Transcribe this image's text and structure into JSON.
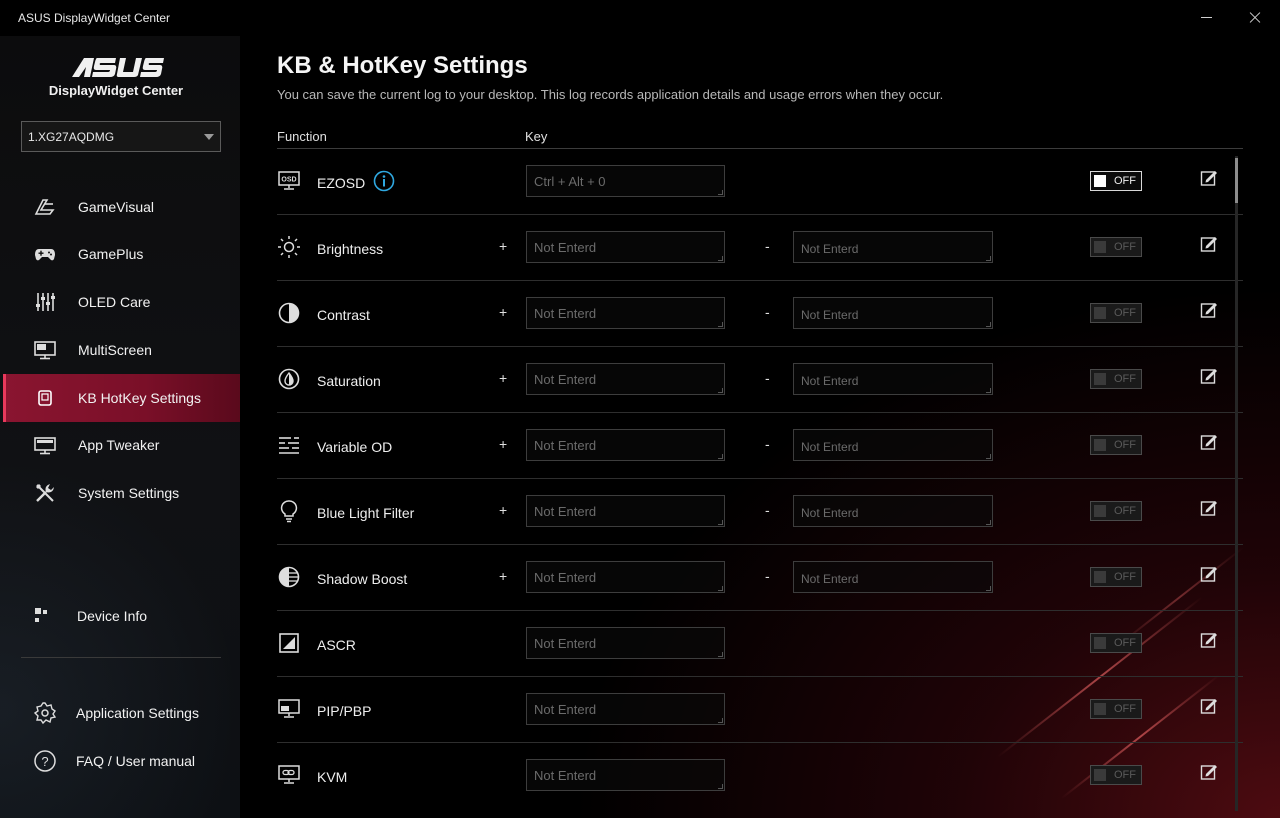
{
  "window": {
    "title": "ASUS DisplayWidget Center"
  },
  "sidebar": {
    "app_name": "DisplayWidget Center",
    "device": "1.XG27AQDMG",
    "items": [
      {
        "label": "GameVisual",
        "icon": "gamevisual-icon"
      },
      {
        "label": "GamePlus",
        "icon": "gamepad-icon"
      },
      {
        "label": "OLED Care",
        "icon": "sliders-icon"
      },
      {
        "label": "MultiScreen",
        "icon": "monitor-icon"
      },
      {
        "label": "KB HotKey Settings",
        "icon": "keyboard-icon",
        "active": true
      },
      {
        "label": "App Tweaker",
        "icon": "monitor-app-icon"
      },
      {
        "label": "System Settings",
        "icon": "wrench-icon"
      },
      {
        "label": "Device Info",
        "icon": "device-info-icon"
      },
      {
        "label": "Application Settings",
        "icon": "gear-icon"
      },
      {
        "label": "FAQ / User manual",
        "icon": "help-icon"
      }
    ]
  },
  "main": {
    "title": "KB & HotKey Settings",
    "subtitle": "You can save the current log to your desktop. This log records application details and usage errors when they occur.",
    "col_function": "Function",
    "col_key": "Key",
    "plus": "+",
    "minus": "-",
    "rows": [
      {
        "name": "EZOSD",
        "icon": "osd-icon",
        "key1": "Ctrl + Alt + 0",
        "toggle": "OFF",
        "toggle_on": true
      },
      {
        "name": "Brightness",
        "icon": "sun-icon",
        "key1": "Not Enterd",
        "key2": "Not Enterd",
        "toggle": "OFF"
      },
      {
        "name": "Contrast",
        "icon": "contrast-icon",
        "key1": "Not Enterd",
        "key2": "Not Enterd",
        "toggle": "OFF"
      },
      {
        "name": "Saturation",
        "icon": "saturation-icon",
        "key1": "Not Enterd",
        "key2": "Not Enterd",
        "toggle": "OFF"
      },
      {
        "name": "Variable OD",
        "icon": "variable-od-icon",
        "key1": "Not Enterd",
        "key2": "Not Enterd",
        "toggle": "OFF"
      },
      {
        "name": "Blue Light Filter",
        "icon": "bulb-icon",
        "key1": "Not Enterd",
        "key2": "Not Enterd",
        "toggle": "OFF"
      },
      {
        "name": "Shadow Boost",
        "icon": "shadow-boost-icon",
        "key1": "Not Enterd",
        "key2": "Not Enterd",
        "toggle": "OFF"
      },
      {
        "name": "ASCR",
        "icon": "ascr-icon",
        "key1": "Not Enterd",
        "toggle": "OFF"
      },
      {
        "name": "PIP/PBP",
        "icon": "pip-icon",
        "key1": "Not Enterd",
        "toggle": "OFF"
      },
      {
        "name": "KVM",
        "icon": "kvm-icon",
        "key1": "Not Enterd",
        "toggle": "OFF"
      }
    ]
  },
  "colors": {
    "accent": "#8a1530",
    "info": "#2fa8e0"
  }
}
